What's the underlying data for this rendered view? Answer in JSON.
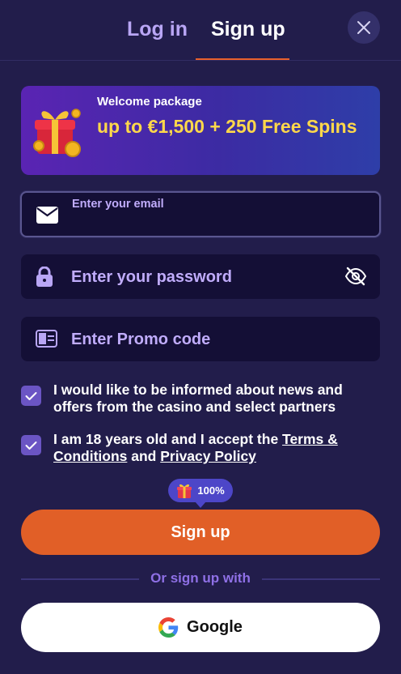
{
  "tabs": {
    "login": "Log in",
    "signup": "Sign up",
    "active": "signup"
  },
  "banner": {
    "subtitle": "Welcome package",
    "title": "up to €1,500 + 250 Free Spins"
  },
  "form": {
    "email": {
      "label": "Enter your email",
      "value": ""
    },
    "password": {
      "placeholder": "Enter your password"
    },
    "promo": {
      "placeholder": "Enter Promo code"
    }
  },
  "consents": {
    "news": {
      "checked": true,
      "text": "I would like to be informed about news and offers from the casino and select partners"
    },
    "age": {
      "checked": true,
      "prefix": "I am 18 years old and I accept the ",
      "terms_link": "Terms & Conditions",
      "middle": " and ",
      "privacy_link": "Privacy Policy"
    }
  },
  "badge": {
    "text": "100%"
  },
  "actions": {
    "signup": "Sign up",
    "divider": "Or sign up with",
    "google": "Google"
  },
  "colors": {
    "background": "#221d4b",
    "accent": "#e15f27",
    "banner_title": "#ffd84a",
    "checkbox": "#6b55c4",
    "badge": "#4d46c8"
  },
  "icons": [
    "close-icon",
    "gift-icon",
    "mail-icon",
    "lock-icon",
    "eye-off-icon",
    "ticket-icon",
    "check-icon",
    "google-logo-icon"
  ]
}
